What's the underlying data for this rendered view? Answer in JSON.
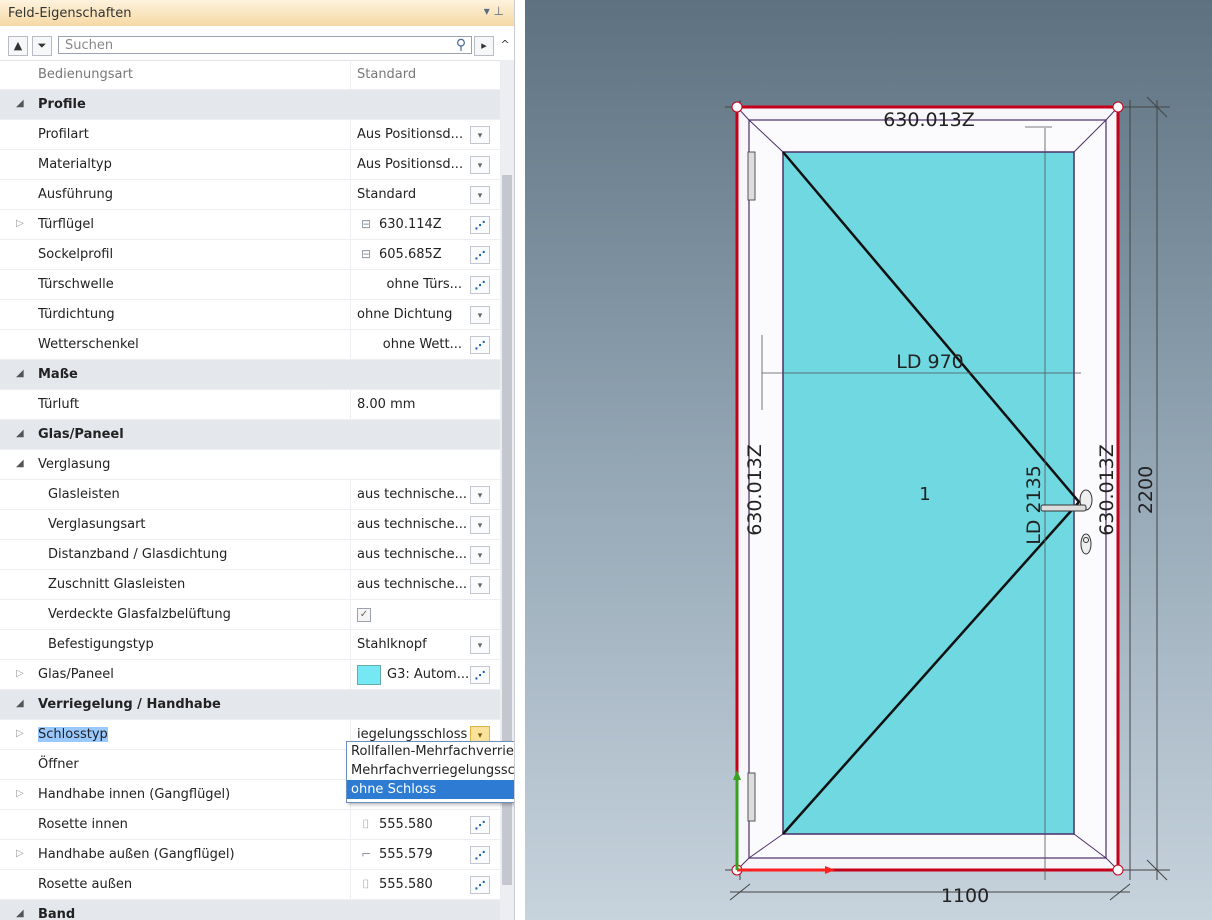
{
  "panel": {
    "title": "Feld-Eigenschaften",
    "title_buttons": "▾ ⊥",
    "search_placeholder": "Suchen",
    "rows": [
      {
        "type": "prop",
        "name": "Bedienungsart",
        "value": "Standard",
        "indent": 38,
        "muted": true
      },
      {
        "type": "cat",
        "name": "Profile"
      },
      {
        "type": "prop",
        "name": "Profilart",
        "value": "Aus Positionsd...",
        "button": "dropdown",
        "indent": 38
      },
      {
        "type": "prop",
        "name": "Materialtyp",
        "value": "Aus Positionsd...",
        "button": "dropdown",
        "indent": 38
      },
      {
        "type": "prop",
        "name": "Ausführung",
        "value": "Standard",
        "button": "dropdown",
        "indent": 38
      },
      {
        "type": "prop",
        "name": "Türflügel",
        "value": "630.114Z",
        "icon": "profile-icon",
        "button": "pick",
        "indent": 38,
        "expandable": true
      },
      {
        "type": "prop",
        "name": "Sockelprofil",
        "value": "605.685Z",
        "icon": "profile-icon",
        "button": "pick",
        "indent": 38
      },
      {
        "type": "prop",
        "name": "Türschwelle",
        "value": "ohne Türs...",
        "align": "right",
        "button": "pick",
        "indent": 38
      },
      {
        "type": "prop",
        "name": "Türdichtung",
        "value": "ohne Dichtung",
        "button": "dropdown",
        "indent": 38
      },
      {
        "type": "prop",
        "name": "Wetterschenkel",
        "value": "ohne Wett...",
        "align": "right",
        "button": "pick",
        "indent": 38
      },
      {
        "type": "cat",
        "name": "Maße"
      },
      {
        "type": "prop",
        "name": "Türluft",
        "value": "8.00 mm",
        "indent": 38
      },
      {
        "type": "cat",
        "name": "Glas/Paneel"
      },
      {
        "type": "sub",
        "name": "Verglasung"
      },
      {
        "type": "prop",
        "name": "Glasleisten",
        "value": "aus technische...",
        "button": "dropdown",
        "indent": 48
      },
      {
        "type": "prop",
        "name": "Verglasungsart",
        "value": "aus technische...",
        "button": "dropdown",
        "indent": 48
      },
      {
        "type": "prop",
        "name": "Distanzband / Glasdichtung",
        "value": "aus technische...",
        "button": "dropdown",
        "indent": 48
      },
      {
        "type": "prop",
        "name": "Zuschnitt Glasleisten",
        "value": "aus technische...",
        "button": "dropdown",
        "indent": 48
      },
      {
        "type": "prop",
        "name": "Verdeckte Glasfalzbelüftung",
        "value": "",
        "checkbox": true,
        "indent": 48
      },
      {
        "type": "prop",
        "name": "Befestigungstyp",
        "value": "Stahlknopf",
        "button": "dropdown",
        "indent": 48
      },
      {
        "type": "prop",
        "name": "Glas/Paneel",
        "value": "G3: Autom...",
        "swatch": true,
        "button": "pick",
        "indent": 38,
        "expandable": true
      },
      {
        "type": "cat",
        "name": "Verriegelung / Handhabe"
      },
      {
        "type": "prop",
        "name": "Schlosstyp",
        "value": "iegelungsschloss",
        "button": "dropdown-active",
        "indent": 38,
        "expandable": true,
        "selected": true
      },
      {
        "type": "prop",
        "name": "Öffner",
        "value": "",
        "indent": 38
      },
      {
        "type": "prop",
        "name": "Handhabe innen (Gangflügel)",
        "value": "",
        "indent": 38,
        "expandable": true
      },
      {
        "type": "prop",
        "name": "Rosette innen",
        "value": "555.580",
        "icon": "rosette-icon",
        "button": "pick",
        "indent": 38
      },
      {
        "type": "prop",
        "name": "Handhabe außen (Gangflügel)",
        "value": "555.579",
        "icon": "handle-icon",
        "button": "pick",
        "indent": 38,
        "expandable": true
      },
      {
        "type": "prop",
        "name": "Rosette außen",
        "value": "555.580",
        "icon": "rosette-icon",
        "button": "pick",
        "indent": 38
      },
      {
        "type": "cat",
        "name": "Band"
      }
    ],
    "dropdown_options": [
      {
        "label": "Rollfallen-Mehrfachverriegelungschloss",
        "selected": false
      },
      {
        "label": "Mehrfachverriegelungsschloss",
        "selected": false
      },
      {
        "label": "ohne Schloss",
        "selected": true
      }
    ]
  },
  "drawing": {
    "top_label": "630.013Z",
    "left_label": "630.013Z",
    "right_label": "630.013Z",
    "ld_width": "LD 970",
    "ld_height": "LD 2135",
    "field_number": "1",
    "height_dim": "2200",
    "width_dim": "1100",
    "glass_color": "#6fd8e0",
    "frame_color": "#c4001a"
  }
}
